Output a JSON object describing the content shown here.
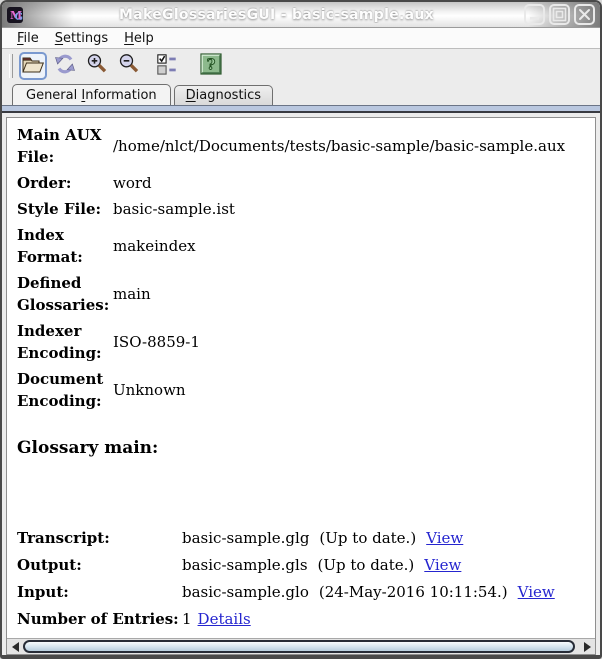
{
  "window": {
    "title": "MakeGlossariesGUI - basic-sample.aux"
  },
  "menubar": {
    "items": [
      {
        "pre": "",
        "key": "F",
        "rest": "ile"
      },
      {
        "pre": "",
        "key": "S",
        "rest": "ettings"
      },
      {
        "pre": "",
        "key": "H",
        "rest": "elp"
      }
    ]
  },
  "toolbar": {
    "buttons": [
      {
        "name": "open",
        "icon": "open-folder-icon"
      },
      {
        "name": "reload",
        "icon": "refresh-icon"
      },
      {
        "name": "zoom-in",
        "icon": "zoom-in-icon"
      },
      {
        "name": "zoom-out",
        "icon": "zoom-out-icon"
      },
      {
        "name": "diagnostic-options",
        "icon": "checkbox-list-icon"
      },
      {
        "name": "help",
        "icon": "help-icon"
      }
    ]
  },
  "tabs": [
    {
      "pre": "General ",
      "key": "I",
      "rest": "nformation",
      "active": true
    },
    {
      "pre": "",
      "key": "D",
      "rest": "iagnostics",
      "active": false
    }
  ],
  "general_info": {
    "fields": [
      {
        "label": "Main AUX File:",
        "value": "/home/nlct/Documents/tests/basic-sample/basic-sample.aux"
      },
      {
        "label": "Order:",
        "value": "word"
      },
      {
        "label": "Style File:",
        "value": "basic-sample.ist"
      },
      {
        "label": "Index Format:",
        "value": "makeindex"
      },
      {
        "label": "Defined Glossaries:",
        "value": "main"
      },
      {
        "label": "Indexer Encoding:",
        "value": "ISO-8859-1"
      },
      {
        "label": "Document Encoding:",
        "value": "Unknown"
      }
    ]
  },
  "glossary": {
    "heading": "Glossary main:",
    "rows": [
      {
        "label": "Transcript:",
        "value": "basic-sample.glg",
        "status": "(Up to date.)",
        "link": "View"
      },
      {
        "label": "Output:",
        "value": "basic-sample.gls",
        "status": "(Up to date.)",
        "link": "View"
      },
      {
        "label": "Input:",
        "value": "basic-sample.glo",
        "status": "(24-May-2016 10:11:54.)",
        "link": "View"
      },
      {
        "label": "Number of Entries:",
        "value": "1",
        "link": "Details"
      }
    ]
  },
  "colors": {
    "link": "#2525cf",
    "tab_band": "#b9c7df",
    "help_green": "#8cb98c",
    "lens_lavender": "#d4d4ec"
  }
}
